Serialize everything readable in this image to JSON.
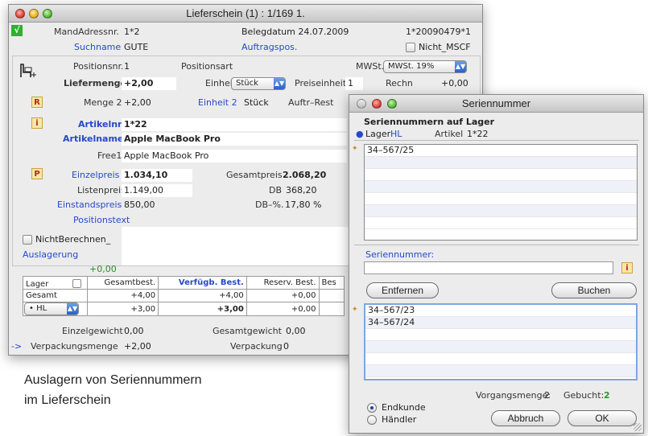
{
  "main": {
    "title": "Lieferschein (1) : 1/169 1.",
    "check_mark": "√",
    "mandadress_label": "MandAdressnr.",
    "mandadress_value": "1*2",
    "belegdatum": "Belegdatum 24.07.2009",
    "docnr": "1*20090479*1",
    "suchname_label": "Suchname",
    "suchname_value": "GUTE",
    "auftragspos": "Auftragspos.",
    "nicht_mscf": "Nicht_MSCF",
    "positionsnr_label": "Positionsnr.",
    "positionsnr_value": "1",
    "positionsart": "Positionsart",
    "mwst_label": "MWSt.",
    "mwst_value": "MWSt. 19%",
    "liefermenge_label": "Liefermenge",
    "liefermenge_value": "+2,00",
    "einheit_label": "Einheit",
    "einheit_value": "Stück",
    "preiseinheit_label": "Preiseinheit",
    "preiseinheit_value": "1",
    "rechn_label": "Rechn",
    "rechn_value": "+0,00",
    "btn_r": "R",
    "menge2_label": "Menge 2",
    "menge2_value": "+2,00",
    "einheit2_label": "Einheit 2",
    "einheit2_value": "Stück",
    "auftrrest_label": "Auftr–Rest",
    "btn_i": "i",
    "artikelnr_label": "Artikelnr.",
    "artikelnr_value": "1*22",
    "artikelname_label": "Artikelname",
    "artikelname_value": "Apple MacBook Pro",
    "free1_label": "Free1",
    "free1_value": "Apple MacBook Pro",
    "btn_p": "P",
    "einzelpreis_label": "Einzelpreis",
    "einzelpreis_value": "1.034,10",
    "gesamtpreis_label": "Gesamtpreis",
    "gesamtpreis_value": "2.068,20",
    "listenpreis_label": "Listenpreis",
    "listenpreis_value": "1.149,00",
    "db_label": "DB",
    "db_value": "368,20",
    "einstandspreis_label": "Einstandspreis",
    "einstandspreis_value": "850,00",
    "dbp_label": "DB–%.",
    "dbp_value": "17,80 %",
    "positionstext": "Positionstext",
    "nichtberechnen": "NichtBerechnen_",
    "auslagerung": "Auslagerung",
    "auslagerung_value": "+0,00",
    "table": {
      "headers": [
        "Lager",
        "Gesamtbest.",
        "Verfügb. Best.",
        "Reserv. Best.",
        "Bes"
      ],
      "row1": [
        "Gesamt",
        "+4,00",
        "+4,00",
        "+0,00"
      ],
      "row2": [
        "• HL",
        "+3,00",
        "+3,00",
        "+0,00"
      ]
    },
    "einzelgewicht_label": "Einzelgewicht",
    "einzelgewicht_value": "0,00",
    "gesamtgewicht_label": "Gesamtgewicht",
    "gesamtgewicht_value": "0,00",
    "arrow": "->",
    "verpackungsmenge_label": "Verpackungsmenge",
    "verpackungsmenge_value": "+2,00",
    "verpackung_label": "Verpackung",
    "verpackung_value": "0"
  },
  "dialog": {
    "title": "Seriennummer",
    "heading": "Seriennummern auf Lager",
    "lager_label": "Lager",
    "lager_value": "HL",
    "artikel_label": "Artikel",
    "artikel_value": "1*22",
    "list1": [
      "34–567/25"
    ],
    "serien_label": "Seriennummer:",
    "btn_i": "i",
    "btn_entfernen": "Entfernen",
    "btn_buchen": "Buchen",
    "list2": [
      "34–567/23",
      "34–567/24"
    ],
    "vorgangsmenge_label": "Vorgangsmenge:",
    "vorgangsmenge_value": "2",
    "gebucht_label": "Gebucht:",
    "gebucht_value": "2",
    "radio1": "Endkunde",
    "radio2": "Händler",
    "btn_abbruch": "Abbruch",
    "btn_ok": "OK"
  },
  "caption": {
    "line1": "Auslagern von Seriennummern",
    "line2": "im Lieferschein"
  }
}
